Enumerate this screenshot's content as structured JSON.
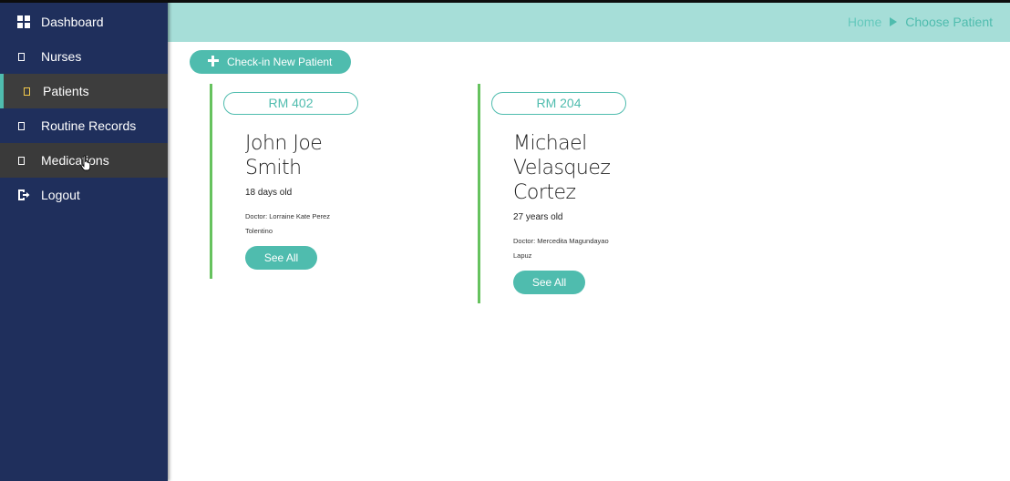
{
  "sidebar": {
    "items": [
      {
        "label": "Dashboard",
        "icon": "dashboard-grid-icon"
      },
      {
        "label": "Nurses",
        "icon": "square-icon"
      },
      {
        "label": "Patients",
        "icon": "square-icon",
        "active": true
      },
      {
        "label": "Routine Records",
        "icon": "square-icon"
      },
      {
        "label": "Medications",
        "icon": "square-icon",
        "hover": true
      },
      {
        "label": "Logout",
        "icon": "logout-icon"
      }
    ]
  },
  "header": {
    "breadcrumb": {
      "home": "Home",
      "current": "Choose Patient"
    }
  },
  "actions": {
    "checkin_label": "Check-in New Patient"
  },
  "patients": [
    {
      "room": "RM 402",
      "name_lines": [
        "John Joe",
        "Smith"
      ],
      "age": "18 days old",
      "doctor_lines": [
        "Doctor: Lorraine Kate Perez",
        "Tolentino"
      ],
      "button": "See All"
    },
    {
      "room": "RM 204",
      "name_lines": [
        "Michael",
        "Velasquez",
        "Cortez"
      ],
      "age": "27 years old",
      "doctor_lines": [
        "Doctor: Mercedita Magundayao",
        "Lapuz"
      ],
      "button": "See All"
    }
  ],
  "colors": {
    "sidebar_bg": "#1f2f5c",
    "accent": "#4fbcae",
    "header_bg": "#a6ded8",
    "card_border": "#66c25e",
    "active_item_bg": "#3d3d3d"
  }
}
